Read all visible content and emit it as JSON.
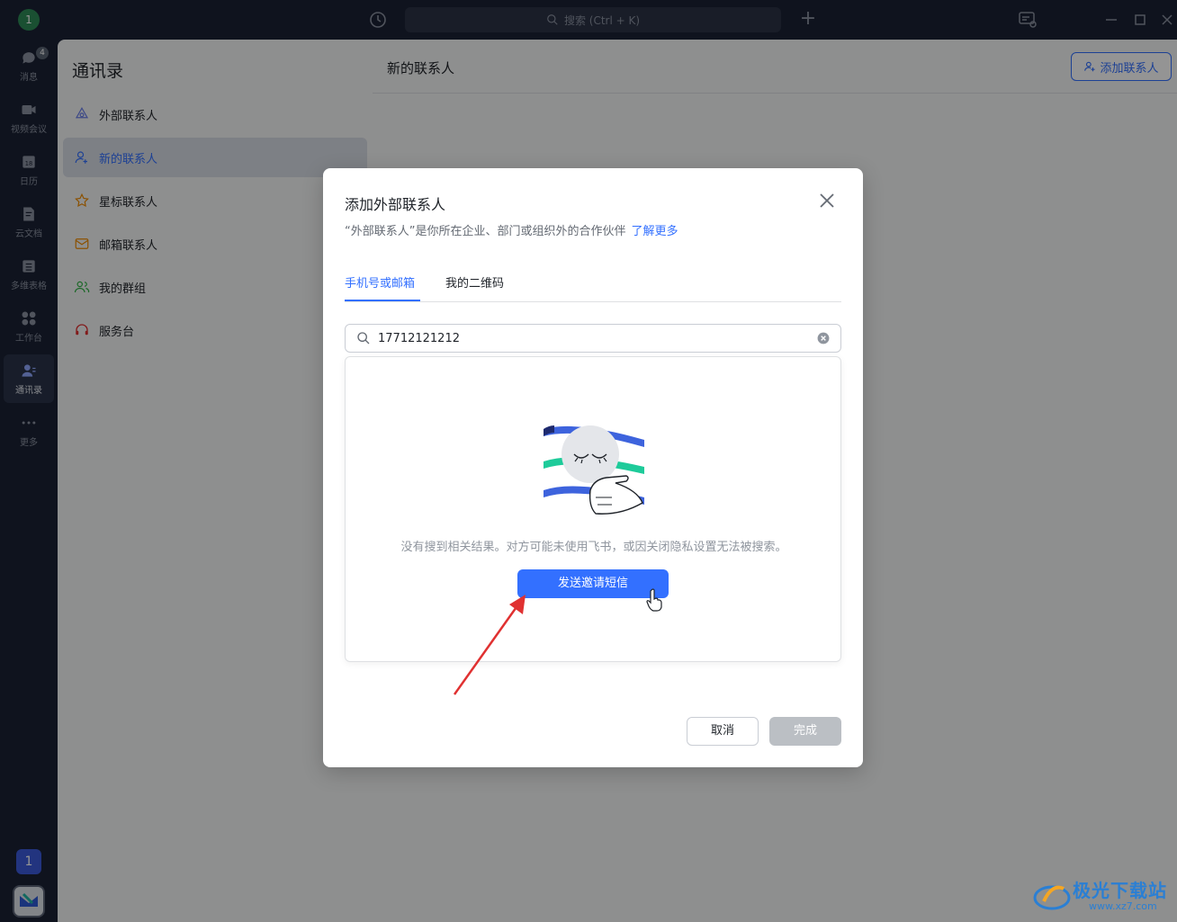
{
  "titlebar": {
    "avatar_initial": "1",
    "search_placeholder": "搜索 (Ctrl + K)",
    "plus_label": "+"
  },
  "rail": {
    "items": [
      {
        "label": "消息",
        "icon": "chat-bubble-icon",
        "badge": "4"
      },
      {
        "label": "视频会议",
        "icon": "video-camera-icon"
      },
      {
        "label": "日历",
        "icon": "calendar-icon",
        "day": "18"
      },
      {
        "label": "云文档",
        "icon": "cloud-doc-icon"
      },
      {
        "label": "多维表格",
        "icon": "table-icon"
      },
      {
        "label": "工作台",
        "icon": "workspace-grid-icon"
      },
      {
        "label": "通讯录",
        "icon": "contacts-icon",
        "active": true
      },
      {
        "label": "更多",
        "icon": "more-dots-icon"
      }
    ],
    "bottom_number": "1"
  },
  "contacts": {
    "title": "通讯录",
    "menu": [
      {
        "label": "外部联系人",
        "icon": "external-contacts-icon"
      },
      {
        "label": "新的联系人",
        "icon": "new-contact-icon",
        "active": true
      },
      {
        "label": "星标联系人",
        "icon": "star-icon"
      },
      {
        "label": "邮箱联系人",
        "icon": "mail-contact-icon"
      },
      {
        "label": "我的群组",
        "icon": "group-icon"
      },
      {
        "label": "服务台",
        "icon": "headset-icon"
      }
    ]
  },
  "main": {
    "title": "新的联系人",
    "add_button": "添加联系人"
  },
  "dialog": {
    "title": "添加外部联系人",
    "description": "“外部联系人”是你所在企业、部门或组织外的合作伙伴",
    "learn_more": "了解更多",
    "tabs": [
      "手机号或邮箱",
      "我的二维码"
    ],
    "search_value": "17712121212",
    "empty_message": "没有搜到相关结果。对方可能未使用飞书，或因关闭隐私设置无法被搜索。",
    "invite_button": "发送邀请短信",
    "cancel_button": "取消",
    "done_button": "完成"
  },
  "watermark": {
    "text": "极光下载站",
    "url": "www.xz7.com"
  },
  "colors": {
    "accent": "#3370ff",
    "sidebar_bg": "#1b2234",
    "annotation_arrow": "#e03131"
  }
}
